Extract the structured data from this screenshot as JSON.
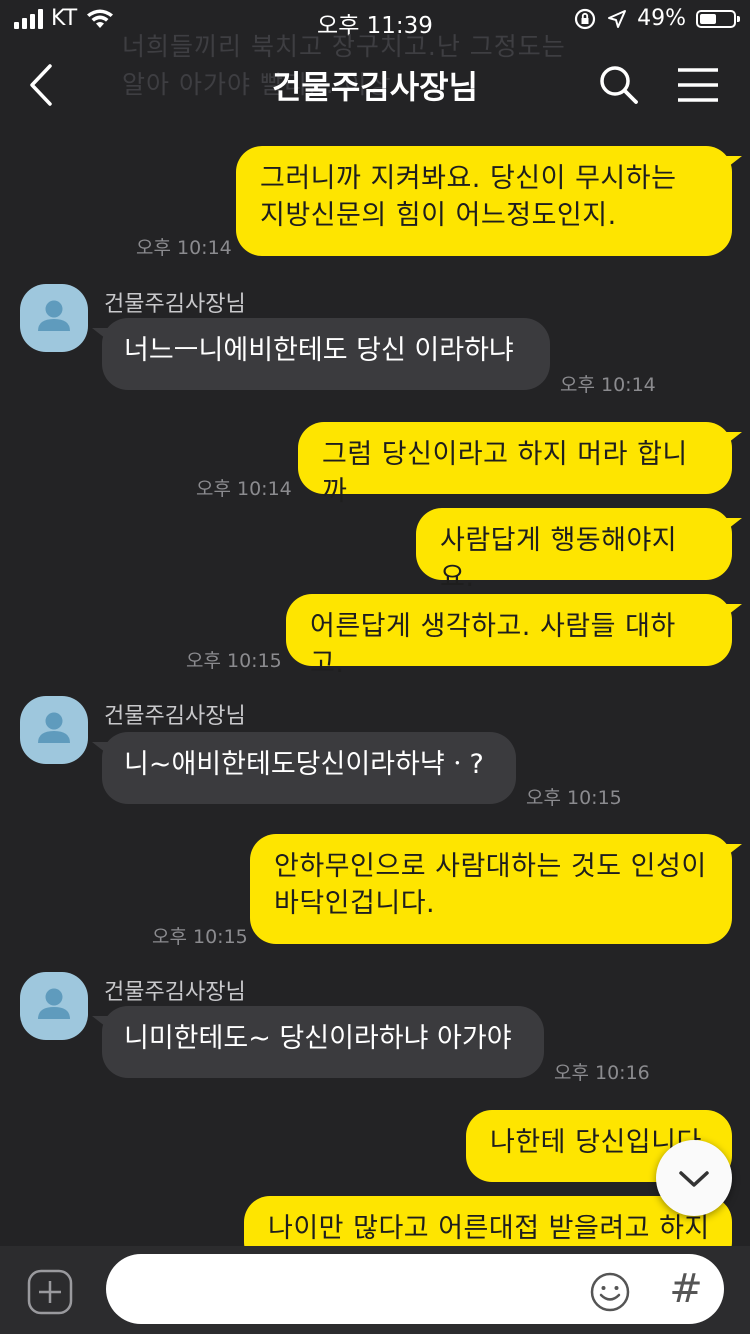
{
  "status": {
    "carrier": "KT",
    "time": "오후 11:39",
    "battery": "49%"
  },
  "header": {
    "title": "건물주김사장님",
    "faded_previous_text": "너희들끼리 북치고 장구치고.난 그정도는 알아 아가야 빨리... 이상"
  },
  "messages": [
    {
      "type": "out",
      "text": "그러니까 지켜봐요. 당신이 무시하는 지방신문의 힘이 어느정도인지.",
      "time": "오후 10:14"
    },
    {
      "type": "in",
      "sender": "건물주김사장님",
      "text": "너느ㅡ니에비한테도 당신 이라하냐",
      "time": "오후 10:14"
    },
    {
      "type": "out",
      "text": "그럼 당신이라고 하지 머라 합니까",
      "time": "오후 10:14"
    },
    {
      "type": "out",
      "text": "사람답게 행동해야지요.",
      "time": ""
    },
    {
      "type": "out",
      "text": "어른답게 생각하고. 사람들 대하고.",
      "time": "오후 10:15"
    },
    {
      "type": "in",
      "sender": "건물주김사장님",
      "text": "니~애비한테도당신이라하냑ㆍ?",
      "time": "오후 10:15"
    },
    {
      "type": "out",
      "text": "안하무인으로 사람대하는 것도 인성이 바닥인겁니다.",
      "time": "오후 10:15"
    },
    {
      "type": "in",
      "sender": "건물주김사장님",
      "text": "니미한테도~ 당신이라하냐 아가야",
      "time": "오후 10:16"
    },
    {
      "type": "out",
      "text": "나한테 당신입니다.",
      "time": ""
    },
    {
      "type": "out",
      "text": "나이만 많다고 어른대접 받을려고 하지",
      "time": ""
    }
  ],
  "input": {
    "placeholder": "",
    "value": ""
  },
  "icons": {
    "back": "chevron-left-icon",
    "search": "search-icon",
    "menu": "hamburger-icon",
    "avatar": "person-icon",
    "scroll_down": "chevron-down-icon",
    "plus": "plus-icon",
    "emoji": "smiley-icon",
    "hash": "#"
  },
  "colors": {
    "background": "#232325",
    "outgoing_bubble": "#fee500",
    "incoming_bubble": "#3b3b3e",
    "avatar": "#9ec7dd"
  }
}
